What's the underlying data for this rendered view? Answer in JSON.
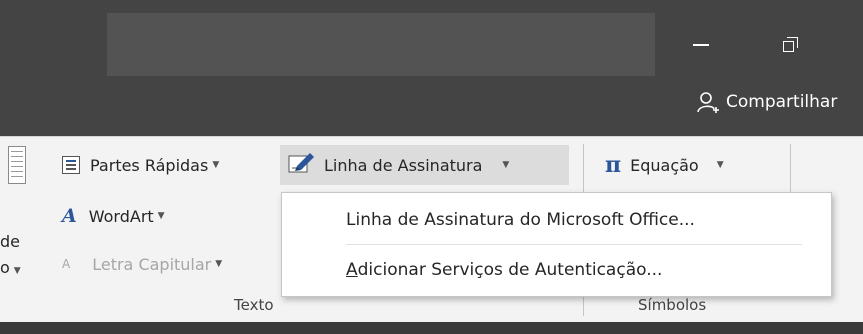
{
  "window": {
    "share_label": "Compartilhar"
  },
  "ribbon": {
    "parts_label": "Partes Rápidas",
    "signature_line_label": "Linha de Assinatura",
    "equation_label": "Equação",
    "wordart_label": "WordArt",
    "dropcap_label": "Letra Capitular",
    "cut_text_1": "de",
    "cut_text_2": "o",
    "group_texto": "Texto",
    "group_simbolos": "Símbolos"
  },
  "menu": {
    "item1": "Linha de Assinatura do Microsoft Office...",
    "item2_mnemonic": "A",
    "item2_rest": "dicionar Serviços de Autenticação..."
  },
  "icons": {
    "dropdown": "chevron-down-icon",
    "equation": "pi-icon",
    "share": "person-add-icon"
  },
  "colors": {
    "titlebar": "#444444",
    "ribbon": "#f3f3f3",
    "accent": "#2b579a",
    "hover": "#dcdcdc"
  }
}
